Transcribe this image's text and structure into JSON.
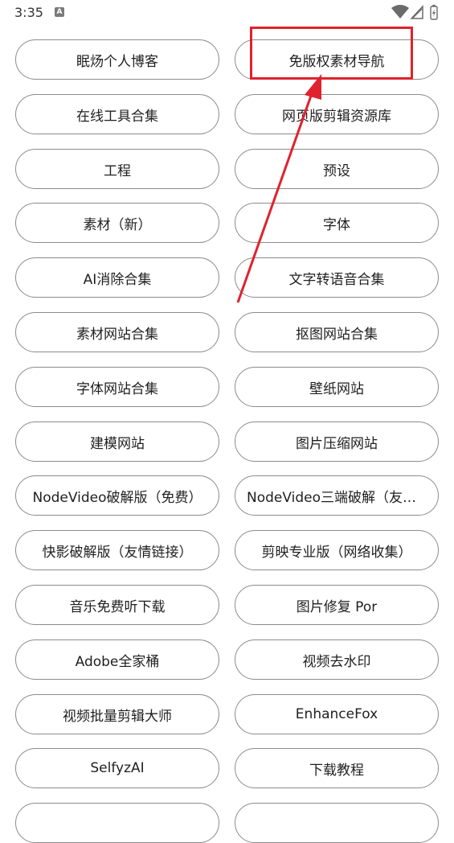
{
  "status_bar": {
    "time": "3:35",
    "notification_glyph": "A",
    "icons": [
      "wifi-icon",
      "cellular-signal-icon",
      "battery-charging-icon"
    ]
  },
  "links": [
    "眠炀个人博客",
    "免版权素材导航",
    "在线工具合集",
    "网页版剪辑资源库",
    "工程",
    "预设",
    "素材（新）",
    "字体",
    "AI消除合集",
    "文字转语音合集",
    "素材网站合集",
    "抠图网站合集",
    "字体网站合集",
    "壁纸网站",
    "建模网站",
    "图片压缩网站",
    "NodeVideo破解版（免费）",
    "NodeVideo三端破解（友情…",
    "快影破解版（友情链接）",
    "剪映专业版（网络收集）",
    "音乐免费听下载",
    "图片修复 Por",
    "Adobe全家桶",
    "视频去水印",
    "视频批量剪辑大师",
    "EnhanceFox",
    "SelfyzAI",
    "下载教程",
    "",
    ""
  ],
  "annotation": {
    "color": "#e0222e",
    "highlighted_link_index": 1
  }
}
